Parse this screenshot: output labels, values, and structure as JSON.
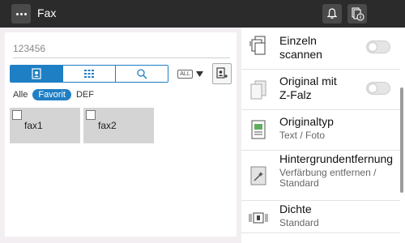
{
  "header": {
    "title": "Fax"
  },
  "address": {
    "value": "123456"
  },
  "toolbar": {
    "all_badge": "ALL"
  },
  "filters": [
    "Alle",
    "Favorit",
    "DEF"
  ],
  "destinations": [
    {
      "label": "fax1"
    },
    {
      "label": "fax2"
    }
  ],
  "settings": [
    {
      "title": "Einzeln\nscannen",
      "toggle": false
    },
    {
      "title": "Original  mit\nZ-Falz",
      "toggle": false
    },
    {
      "title": "Originaltyp",
      "sub": "Text  /  Foto"
    },
    {
      "title": "Hintergrundentfernung",
      "sub": "Verfärbung  entfernen  /\nStandard"
    },
    {
      "title": "Dichte",
      "sub": "Standard"
    }
  ],
  "colors": {
    "topbar": "#2b2b2b",
    "accent": "#1f7fc4",
    "background": "#f3eef1"
  }
}
